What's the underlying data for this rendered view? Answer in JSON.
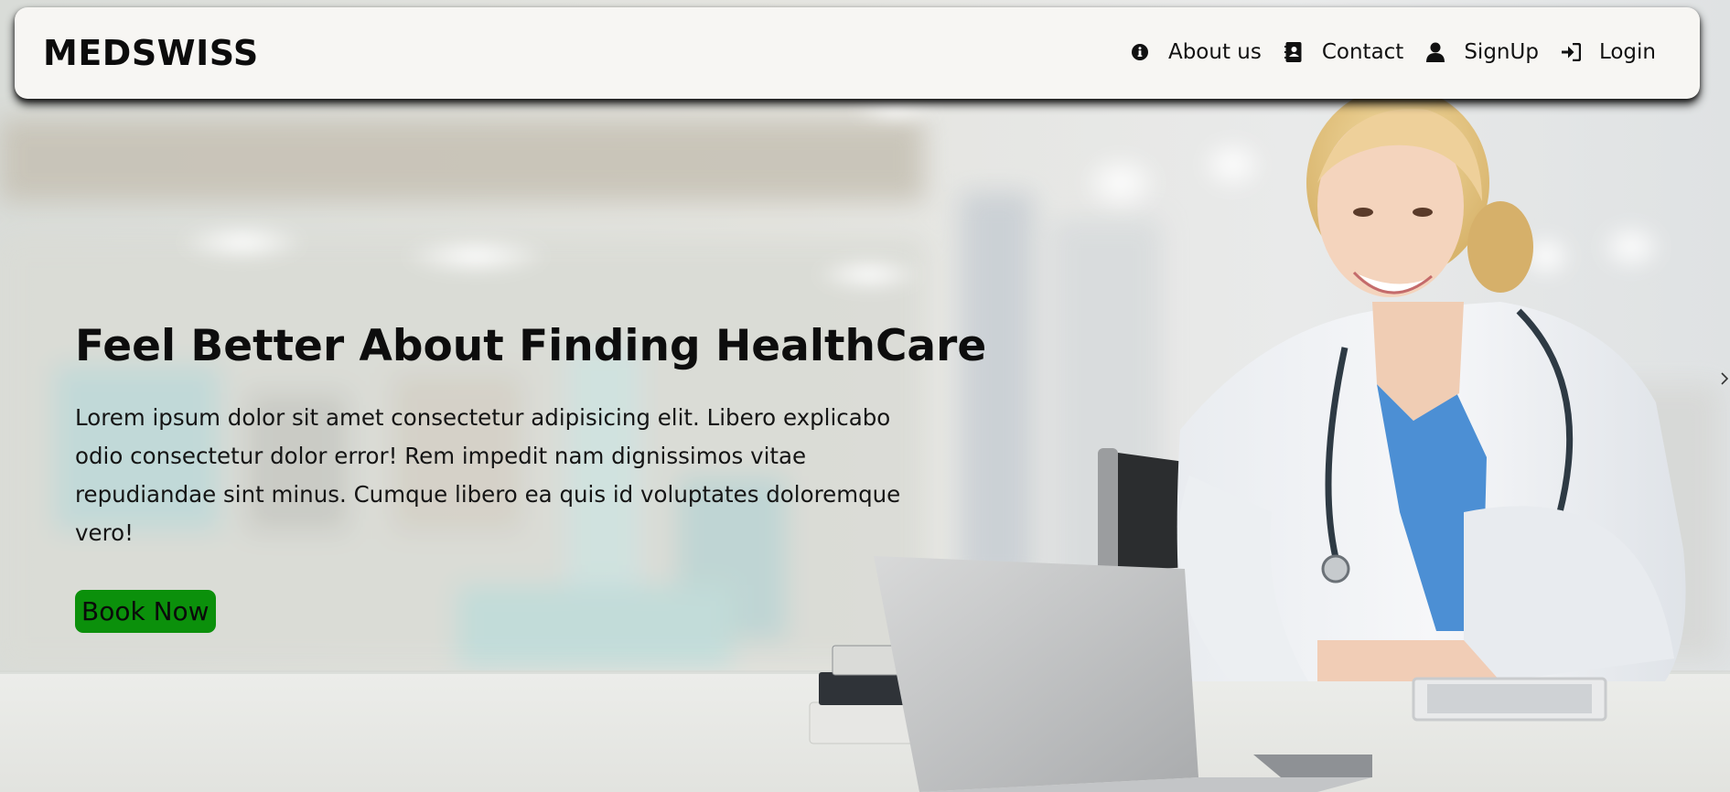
{
  "navbar": {
    "brand": "MEDSWISS",
    "links": [
      {
        "label": "About us",
        "icon": "info-circle-icon"
      },
      {
        "label": "Contact",
        "icon": "address-book-icon"
      },
      {
        "label": "SignUp",
        "icon": "user-icon"
      },
      {
        "label": "Login",
        "icon": "sign-in-icon"
      }
    ]
  },
  "hero": {
    "title": "Feel Better About Finding HealthCare",
    "description": "Lorem ipsum dolor sit amet consectetur adipisicing elit. Libero explicabo odio consectetur dolor error! Rem impedit nam dignissimos vitae repudiandae sint minus. Cumque libero ea quis id voluptates doloremque vero!",
    "cta_label": "Book Now",
    "image": "doctor-at-laptop-photo"
  },
  "colors": {
    "navbar_bg": "#f7f6f3",
    "cta_bg": "#0b900b",
    "text": "#0d0d0d"
  }
}
